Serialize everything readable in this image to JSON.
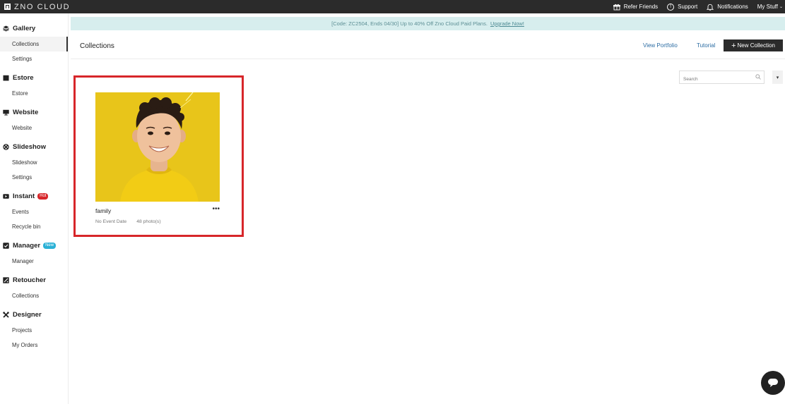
{
  "app": {
    "logo_text": "ZNO CLOUD"
  },
  "topnav": {
    "refer": "Refer Friends",
    "support": "Support",
    "notifications": "Notifications",
    "mystuff": "My Stuff"
  },
  "promo": {
    "text": "[Code: ZC2504, Ends 04/30] Up to 40% Off Zno Cloud Paid Plans.",
    "link": "Upgrade Now!"
  },
  "sidebar": {
    "gallery": {
      "label": "Gallery",
      "items": [
        "Collections",
        "Settings"
      ]
    },
    "estore": {
      "label": "Estore",
      "items": [
        "Estore"
      ]
    },
    "website": {
      "label": "Website",
      "items": [
        "Website"
      ]
    },
    "slideshow": {
      "label": "Slideshow",
      "items": [
        "Slideshow",
        "Settings"
      ]
    },
    "instant": {
      "label": "Instant",
      "badge": "Hot",
      "items": [
        "Events",
        "Recycle bin"
      ]
    },
    "manager": {
      "label": "Manager",
      "badge": "New",
      "items": [
        "Manager"
      ]
    },
    "retoucher": {
      "label": "Retoucher",
      "items": [
        "Collections"
      ]
    },
    "designer": {
      "label": "Designer",
      "items": [
        "Projects",
        "My Orders"
      ]
    }
  },
  "header": {
    "title": "Collections",
    "view_portfolio": "View Portfolio",
    "tutorial": "Tutorial",
    "new_collection": "New Collection"
  },
  "search": {
    "placeholder": "Search"
  },
  "collections": [
    {
      "name": "family",
      "event_date": "No Event Date",
      "photos": "48 photo(s)"
    }
  ],
  "colors": {
    "topbar": "#2b2b2b",
    "promo_bg": "#d7eeee",
    "highlight": "#d7262a",
    "thumb_bg": "#e8c51a"
  }
}
